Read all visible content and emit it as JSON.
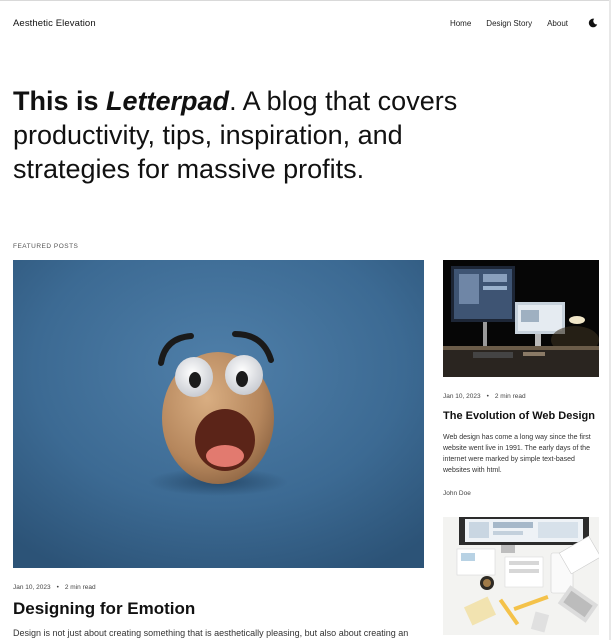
{
  "site": {
    "title": "Aesthetic Elevation"
  },
  "nav": {
    "items": [
      "Home",
      "Design Story",
      "About"
    ],
    "theme_icon": "moon-icon"
  },
  "hero": {
    "prefix": "This is ",
    "name": "Letterpad",
    "rest": ". A blog that covers productivity, tips, inspiration, and strategies for massive profits."
  },
  "featured": {
    "label": "FEATURED POSTS",
    "main": {
      "date": "Jan 10, 2023",
      "read_time": "2 min read",
      "title": "Designing for Emotion",
      "excerpt": "Design is not just about creating something that is aesthetically pleasing, but also about creating an"
    },
    "side": {
      "date": "Jan 10, 2023",
      "read_time": "2 min read",
      "title": "The Evolution of Web Design",
      "excerpt": "Web design has come a long way since the first website went live in 1991. The early days of the internet were marked by simple text-based websites with html.",
      "author": "John Doe"
    }
  },
  "colors": {
    "main_image_bg": "#3d6c95",
    "side_image_bg": "#070707"
  }
}
